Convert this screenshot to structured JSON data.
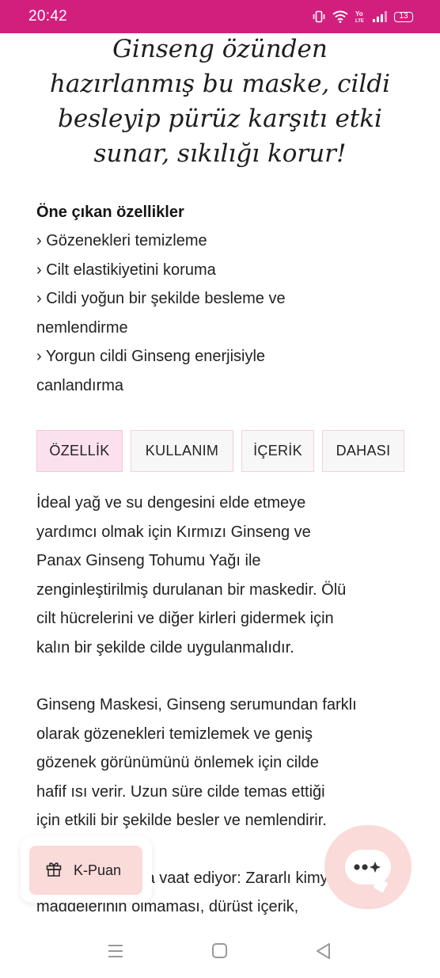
{
  "status_bar": {
    "time": "20:42",
    "battery": "13",
    "icons": [
      "vibrate-icon",
      "wifi-icon",
      "volte-icon",
      "signal-icon",
      "battery-icon"
    ]
  },
  "headline": [
    "Ginseng özünden",
    "hazırlanmış bu maske, cildi",
    "besleyip pürüz karşıtı etki",
    "sunar, sıkılığı korur!"
  ],
  "features": {
    "title": "Öne çıkan özellikler",
    "lines": [
      "› Gözenekleri temizleme",
      "› Cilt elastikiyetini koruma",
      "› Cildi yoğun bir şekilde besleme ve",
      "nemlendirme",
      "› Yorgun cildi Ginseng enerjisiyle",
      "canlandırma"
    ]
  },
  "tabs": [
    {
      "label": "ÖZELLİK",
      "active": true
    },
    {
      "label": "KULLANIM",
      "active": false
    },
    {
      "label": "İÇERİK",
      "active": false
    },
    {
      "label": "DAHASI",
      "active": false
    }
  ],
  "paragraphs": [
    [
      "İdeal yağ ve su dengesini elde etmeye",
      "yardımcı olmak için Kırmızı Ginseng ve",
      "Panax Ginseng Tohumu Yağı ile",
      "zenginleştirilmiş durulanan bir maskedir. Ölü",
      "cilt hücrelerini ve diğer kirleri gidermek için",
      "kalın bir şekilde cilde uygulanmalıdır."
    ],
    [
      "Ginseng Maskesi, Ginseng serumundan farklı",
      "olarak gözenekleri temizlemek ve geniş",
      "gözenek görünümünü önlemek için cilde",
      "hafif ısı verir. Uzun süre cilde temas ettiği",
      "için etkili bir şekilde besler ve nemlendirir."
    ],
    [
      "Ayrıca şunları da vaat ediyor: Zararlı kimyasal",
      "maddelerinin olmaması, dürüst içerik,"
    ]
  ],
  "floating": {
    "kpuan_label": "K-Puan",
    "kpuan_icon": "gift-icon",
    "chat_icon": "chat-icon"
  },
  "nav": {
    "icons": [
      "recent-apps-icon",
      "home-icon",
      "back-icon"
    ]
  },
  "colors": {
    "status_bar": "#d21f7e",
    "tab_active": "#fbe1ee",
    "tab_border": "#f4cfdc",
    "kpuan_bg": "#fbdada",
    "chat_bg": "#fbdada"
  }
}
